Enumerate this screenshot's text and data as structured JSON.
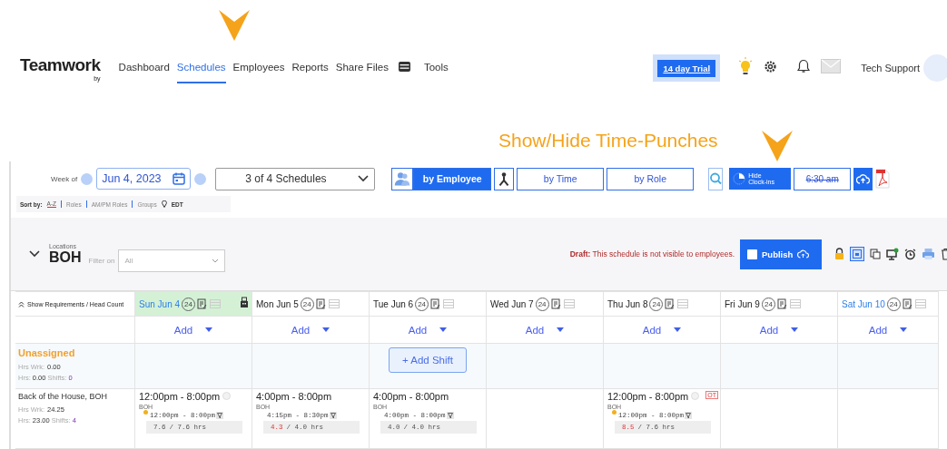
{
  "logo": {
    "name": "Teamwork",
    "byline": "by"
  },
  "nav": [
    {
      "kind": "link",
      "label": "Dashboard",
      "selected": false
    },
    {
      "kind": "link",
      "label": "Schedules",
      "selected": true
    },
    {
      "kind": "link",
      "label": "Employees",
      "selected": false
    },
    {
      "kind": "link",
      "label": "Reports",
      "selected": false
    },
    {
      "kind": "link",
      "label": "Share Files",
      "selected": false
    },
    {
      "kind": "icon",
      "selected": false
    },
    {
      "kind": "link",
      "label": "Tools",
      "selected": false
    }
  ],
  "trial_button": "14 day Trial",
  "user": {
    "name": "Tech Support"
  },
  "annotation": "Show/Hide Time-Punches",
  "toolbar": {
    "week_label": "Week of",
    "date": "Jun 4, 2023",
    "schedules": "3 of 4 Schedules",
    "views": [
      {
        "label": "by Employee",
        "selected": true
      },
      {
        "label": "by Time",
        "selected": false
      },
      {
        "label": "by Role",
        "selected": false
      }
    ],
    "clockins_button": [
      "Hide",
      "Clock-ins"
    ],
    "time_button": "6:30 am"
  },
  "sort": {
    "label": "Sort by:",
    "options": [
      {
        "label": "A-Z",
        "selected": true
      },
      {
        "label": "Roles",
        "selected": false
      },
      {
        "label": "AM/PM Roles",
        "selected": false
      },
      {
        "label": "Groups",
        "selected": false
      }
    ],
    "timezone": "EDT"
  },
  "location": {
    "label": "Locations",
    "name": "BOH",
    "filter_label": "Filter on",
    "filter_value": "All",
    "notice": "**Draft:** This schedule is not visible to employees.",
    "publish": "Publish"
  },
  "grid": {
    "corner": "Show Requirements / Head Count",
    "days": [
      {
        "label": "Sun Jun 4",
        "badge": "24",
        "today": true,
        "weekend": true,
        "add": "Add"
      },
      {
        "label": "Mon Jun 5",
        "badge": "24",
        "today": false,
        "weekend": false,
        "add": "Add"
      },
      {
        "label": "Tue Jun 6",
        "badge": "24",
        "today": false,
        "weekend": false,
        "add": "Add"
      },
      {
        "label": "Wed Jun 7",
        "badge": "24",
        "today": false,
        "weekend": false,
        "add": "Add"
      },
      {
        "label": "Thu Jun 8",
        "badge": "24",
        "today": false,
        "weekend": false,
        "add": "Add"
      },
      {
        "label": "Fri Jun 9",
        "badge": "24",
        "today": false,
        "weekend": false,
        "add": "Add"
      },
      {
        "label": "Sat Jun 10",
        "badge": "24",
        "today": false,
        "weekend": true,
        "add": "Add"
      }
    ],
    "rows": [
      {
        "kind": "unassigned",
        "name": "Unassigned",
        "hrs_wrk_label": "Hrs Wrk:",
        "hrs_wrk": "0.00",
        "hrs_label": "Hrs:",
        "hrs": "0.00",
        "shifts_label": "Shifts:",
        "shifts": "0",
        "cells": [
          null,
          null,
          {
            "add_shift": "+ Add Shift"
          },
          null,
          null,
          null,
          null
        ]
      },
      {
        "kind": "employee",
        "name": "Back of the House, BOH",
        "hrs_wrk_label": "Hrs Wrk:",
        "hrs_wrk": "24.25",
        "hrs_label": "Hrs:",
        "hrs": "23.00",
        "shifts_label": "Shifts:",
        "shifts": "4",
        "cells": [
          {
            "time": "12:00pm - 8:00pm",
            "pending": true,
            "role": "BOH",
            "punch_flag": true,
            "punch": "12:00pm - 8:00pm",
            "actual": "7.6",
            "over": false,
            "planned": "/ 7.6 hrs"
          },
          {
            "time": "4:00pm - 8:00pm",
            "pending": false,
            "role": "BOH",
            "punch_flag": false,
            "punch": "4:15pm - 8:30pm",
            "actual": "4.3",
            "over": true,
            "planned": "/ 4.0 hrs"
          },
          {
            "time": "4:00pm - 8:00pm",
            "pending": false,
            "role": "BOH",
            "punch_flag": false,
            "punch": "4:00pm - 8:00pm",
            "actual": "4.0",
            "over": false,
            "planned": "/ 4.0 hrs"
          },
          null,
          {
            "time": "12:00pm - 8:00pm",
            "pending": true,
            "ot": "OT",
            "role": "BOH",
            "punch_flag": true,
            "punch": "12:00pm - 8:00pm",
            "actual": "8.5",
            "over": true,
            "planned": "/ 7.6 hrs"
          },
          null,
          null
        ]
      }
    ]
  }
}
